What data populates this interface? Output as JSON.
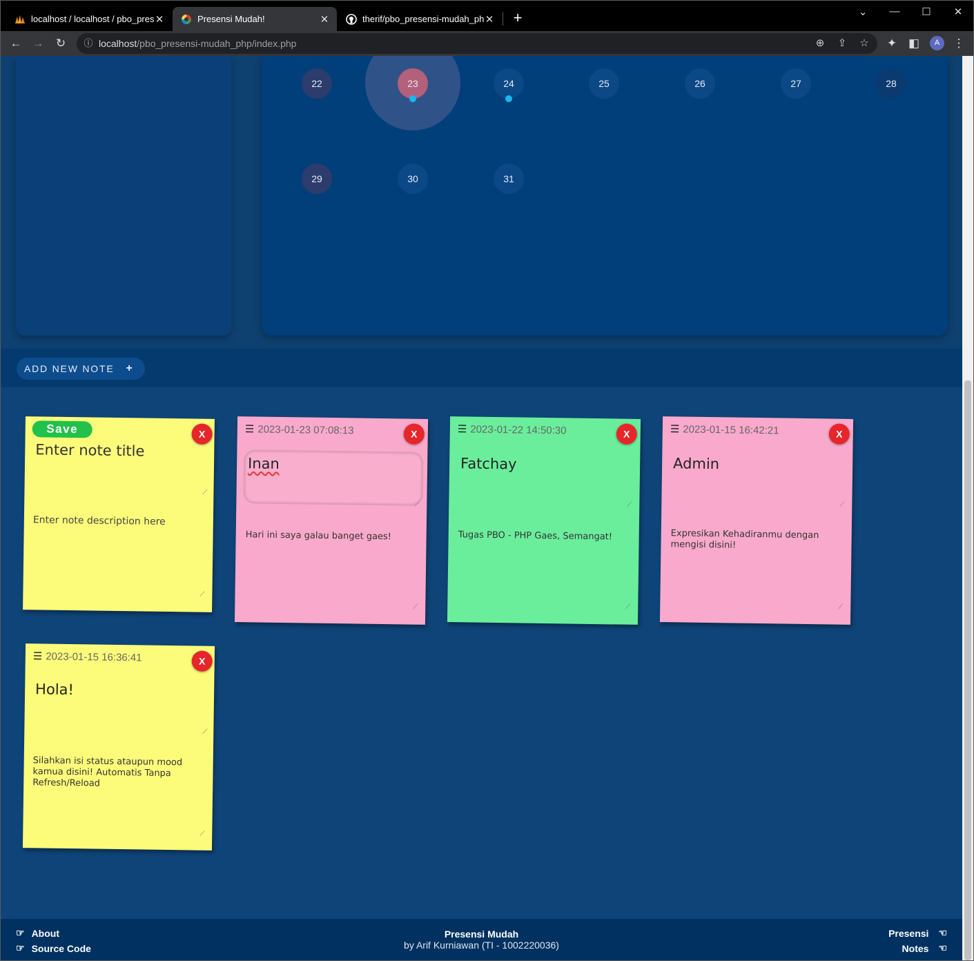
{
  "browser": {
    "tabs": [
      {
        "title": "localhost / localhost / pbo_presensi_mudah",
        "active": false
      },
      {
        "title": "Presensi Mudah!",
        "active": true
      },
      {
        "title": "therif/pbo_presensi-mudah_php: Mini",
        "active": false
      }
    ],
    "url_host": "localhost",
    "url_path": "/pbo_presensi-mudah_php/index.php",
    "profile_initial": "A"
  },
  "calendar": {
    "week_row": [
      "22",
      "23",
      "24",
      "25",
      "26",
      "27",
      "28"
    ],
    "last_row": [
      "29",
      "30",
      "31"
    ],
    "today": "23",
    "days_with_notes": [
      "23",
      "24"
    ]
  },
  "notes_bar": {
    "add_label": "ADD NEW NOTE",
    "add_icon": "+"
  },
  "new_note": {
    "save_label": "Save",
    "title_placeholder": "Enter note title",
    "desc_placeholder": "Enter note description here",
    "color": "#fdfc7a"
  },
  "notes": [
    {
      "timestamp": "2023-01-23 07:08:13",
      "title": "Inan",
      "description": "Hari ini saya galau banget gaes!",
      "color": "#f9a9cb"
    },
    {
      "timestamp": "2023-01-22 14:50:30",
      "title": "Fatchay",
      "description": "Tugas PBO - PHP Gaes, Semangat!",
      "color": "#6aee9c"
    },
    {
      "timestamp": "2023-01-15 16:42:21",
      "title": "Admin",
      "description": "Expresikan Kehadiranmu dengan mengisi disini!",
      "color": "#f9a9cb"
    },
    {
      "timestamp": "2023-01-15 16:36:41",
      "title": "Hola!",
      "description": "Silahkan isi status ataupun mood kamua disini! Automatis Tanpa Refresh/Reload",
      "color": "#fdfc7a"
    }
  ],
  "delete_label": "X",
  "footer": {
    "about": "About",
    "source_code": "Source Code",
    "title": "Presensi Mudah",
    "byline": "by Arif Kurniawan (TI - 1002220036)",
    "presensi": "Presensi",
    "notes": "Notes"
  }
}
